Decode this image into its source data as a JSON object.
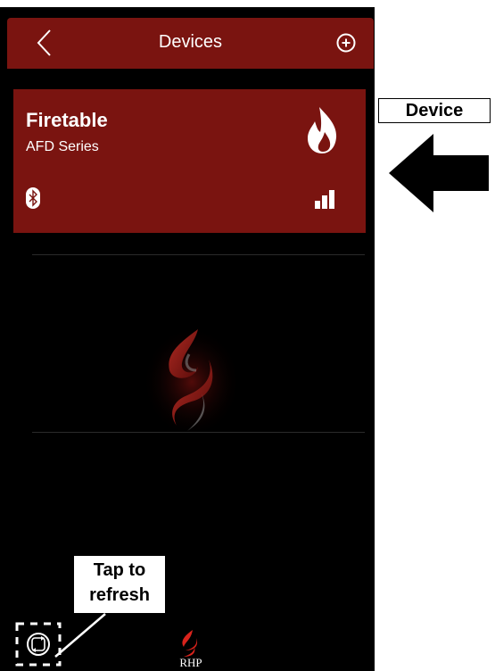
{
  "header": {
    "title": "Devices",
    "back_icon": "chevron-left-icon",
    "add_icon": "plus-circle-icon"
  },
  "device": {
    "name": "Firetable",
    "series": "AFD Series",
    "type_icon": "flame-icon",
    "connection_icon": "bluetooth-icon",
    "signal_icon": "signal-strength-icon",
    "signal_level": 0.75
  },
  "annotations": {
    "device_label": "Device",
    "refresh_label_line1": "Tap to",
    "refresh_label_line2": "refresh"
  },
  "footer": {
    "refresh_icon": "refresh-icon",
    "brand_logo_text": "RHP"
  },
  "colors": {
    "brand_red": "#7a1410",
    "background": "#000000"
  }
}
